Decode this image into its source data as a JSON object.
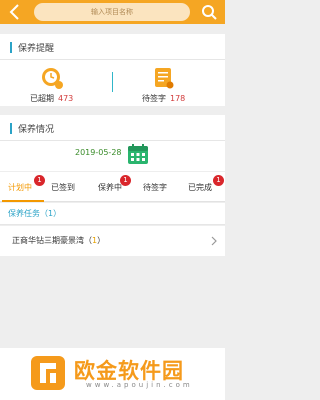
{
  "header": {
    "search_placeholder": "输入项目名称",
    "back_icon": "back-chevron-icon",
    "search_icon": "search-icon"
  },
  "reminder": {
    "title": "保养提醒",
    "overdue_label": "已超期",
    "overdue_count": "473",
    "pending_label": "待签字",
    "pending_count": "178"
  },
  "status": {
    "title": "保养情况",
    "date": "2019-05-28"
  },
  "tabs": [
    {
      "label": "计划中",
      "badge": "1",
      "active": true
    },
    {
      "label": "已签到",
      "badge": ""
    },
    {
      "label": "保养中",
      "badge": "1"
    },
    {
      "label": "待签字",
      "badge": ""
    },
    {
      "label": "已完成",
      "badge": "1"
    }
  ],
  "tasks": {
    "group_label": "保养任务（1）",
    "items": [
      {
        "name": "正商华钻三期豪景湾",
        "open": "（",
        "count": "1",
        "close": "）"
      }
    ]
  },
  "watermark": {
    "brand": "欧金软件园",
    "url": "www.apoujin.com"
  },
  "colors": {
    "accent": "#f5a623",
    "section_bar": "#2ba3c7",
    "alert_red": "#d9262b",
    "active_tab": "#f39800"
  }
}
